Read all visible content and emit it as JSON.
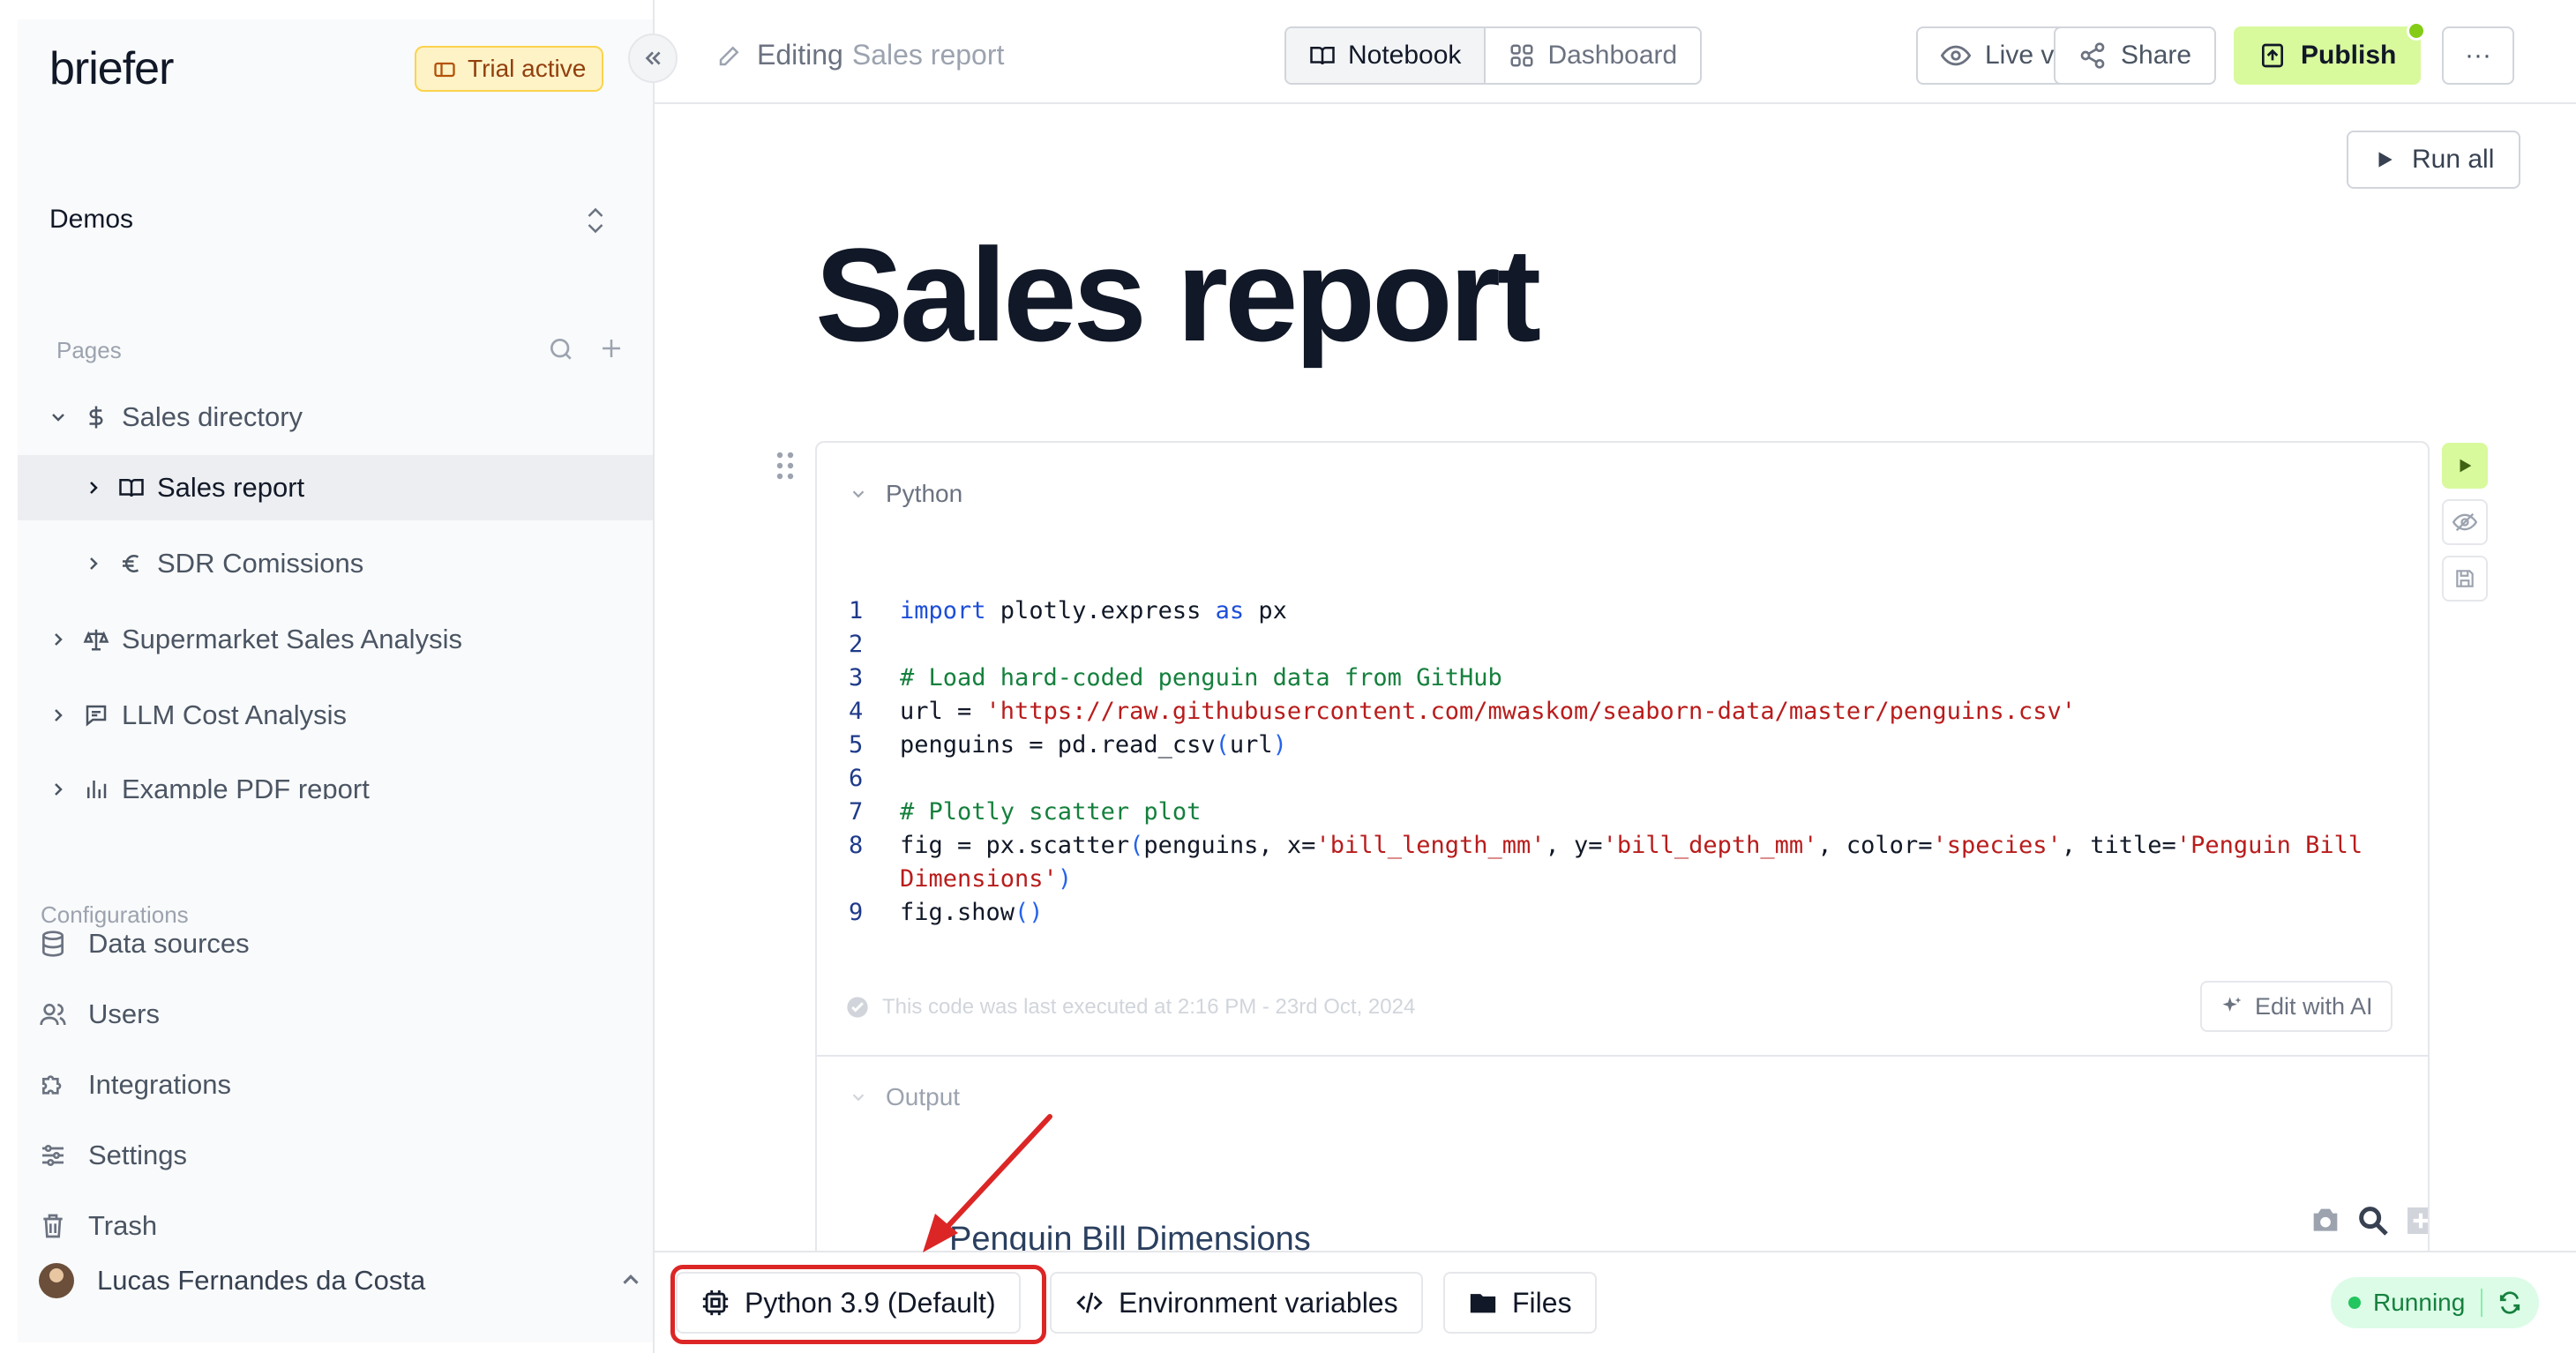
{
  "app": {
    "logo": "briefer",
    "trial_badge": "Trial active"
  },
  "sidebar": {
    "workspace": "Demos",
    "pages_label": "Pages",
    "pages": [
      {
        "label": "Sales directory",
        "icon": "dollar-icon"
      },
      {
        "label": "Sales report",
        "icon": "book-icon"
      },
      {
        "label": "SDR Comissions",
        "icon": "euro-icon"
      },
      {
        "label": "Supermarket Sales Analysis",
        "icon": "scale-icon"
      },
      {
        "label": "LLM Cost Analysis",
        "icon": "chat-icon"
      },
      {
        "label": "Example PDF report",
        "icon": "bar-chart-icon"
      }
    ],
    "configurations_label": "Configurations",
    "configurations": [
      {
        "label": "Data sources",
        "icon": "database-icon"
      },
      {
        "label": "Users",
        "icon": "users-icon"
      },
      {
        "label": "Integrations",
        "icon": "puzzle-icon"
      },
      {
        "label": "Settings",
        "icon": "sliders-icon"
      },
      {
        "label": "Trash",
        "icon": "trash-icon"
      }
    ],
    "user_name": "Lucas Fernandes da Costa"
  },
  "topbar": {
    "editing_prefix": "Editing",
    "editing_doc": "Sales report",
    "tab_notebook": "Notebook",
    "tab_dashboard": "Dashboard",
    "live_version": "Live version",
    "share": "Share",
    "publish": "Publish",
    "more": "···"
  },
  "main": {
    "run_all": "Run all",
    "title": "Sales report",
    "block_type": "Python",
    "code_lines": [
      {
        "n": "1",
        "html": "<span class=\"kw\">import</span> plotly.express <span class=\"kw\">as</span> px"
      },
      {
        "n": "2",
        "html": ""
      },
      {
        "n": "3",
        "html": "<span class=\"cm\"># Load hard-coded penguin data from GitHub</span>"
      },
      {
        "n": "4",
        "html": "url = <span class=\"st\">'https://raw.githubusercontent.com/mwaskom/seaborn-data/master/penguins.csv'</span>"
      },
      {
        "n": "5",
        "html": "penguins = pd.read_csv<span class=\"pn\">(</span>url<span class=\"pn\">)</span>"
      },
      {
        "n": "6",
        "html": ""
      },
      {
        "n": "7",
        "html": "<span class=\"cm\"># Plotly scatter plot</span>"
      },
      {
        "n": "8",
        "html": "fig = px.scatter<span class=\"pn\">(</span>penguins, x=<span class=\"st\">'bill_length_mm'</span>, y=<span class=\"st\">'bill_depth_mm'</span>, color=<span class=\"st\">'species'</span>, title=<span class=\"st\">'Penguin Bill</span>"
      },
      {
        "n": "",
        "html": "<span class=\"st\">Dimensions'</span><span class=\"pn\">)</span>"
      },
      {
        "n": "9",
        "html": "fig.show<span class=\"pn\">()</span>"
      }
    ],
    "executed_note": "This code was last executed at 2:16 PM - 23rd Oct, 2024",
    "edit_with_ai": "Edit with AI",
    "output_label": "Output",
    "output_chart_title": "Penguin Bill Dimensions"
  },
  "bottombar": {
    "python_env": "Python 3.9 (Default)",
    "env_vars": "Environment variables",
    "files": "Files",
    "status": "Running"
  },
  "colors": {
    "accent_lime": "#d9f99d",
    "annotation_red": "#dc2626",
    "running_green": "#15803d"
  }
}
